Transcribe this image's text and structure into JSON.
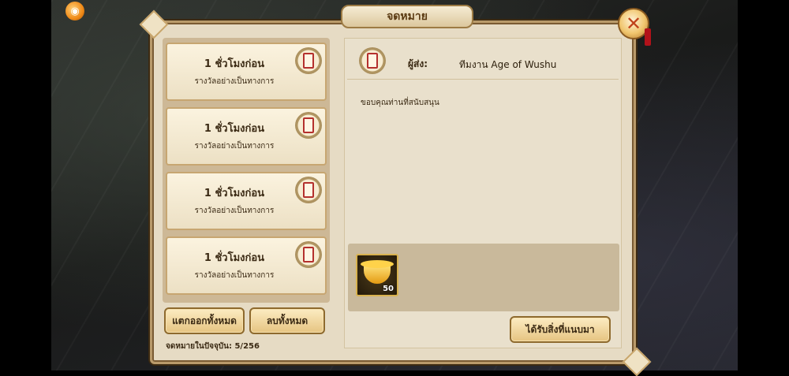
{
  "window": {
    "title": "จดหมาย"
  },
  "mail_list": {
    "items": [
      {
        "time": "1 ชั่วโมงก่อน",
        "subject": "รางวัลอย่างเป็นทางการ"
      },
      {
        "time": "1 ชั่วโมงก่อน",
        "subject": "รางวัลอย่างเป็นทางการ"
      },
      {
        "time": "1 ชั่วโมงก่อน",
        "subject": "รางวัลอย่างเป็นทางการ"
      },
      {
        "time": "1 ชั่วโมงก่อน",
        "subject": "รางวัลอย่างเป็นทางการ"
      }
    ],
    "claim_all_label": "แตกออกทั้งหมด",
    "delete_all_label": "ลบทั้งหมด",
    "count_text": "จดหมายในปัจจุบัน: 5/256"
  },
  "detail": {
    "sender_label": "ผู้ส่ง:",
    "sender_name": "ทีมงาน Age of Wushu",
    "body": "ขอบคุณท่านที่สนับสนุน",
    "attachment": {
      "icon": "gold-ingot-icon",
      "quantity": "50"
    },
    "claim_label": "ได้รับสิ่งที่แนบมา"
  }
}
